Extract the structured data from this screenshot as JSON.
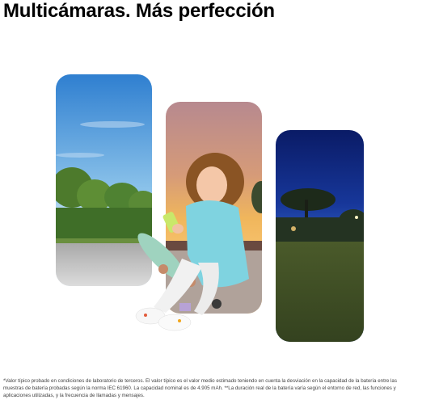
{
  "header": {
    "title": "Multicámaras. Más perfección"
  },
  "photos": [
    {
      "name": "daylight-park-photo"
    },
    {
      "name": "sunset-portrait-photo"
    },
    {
      "name": "night-park-photo"
    }
  ],
  "colors": {
    "sky_day": "#3f8fd8",
    "sky_sunset": "#e0a36c",
    "sky_night": "#0d2370",
    "grass_night": "#3c4e25",
    "hoodie": "#7fd3e0"
  },
  "footnote": {
    "text": "*Valor típico probado en condiciones de laboratorio de terceros. El valor típico es el valor medio estimado teniendo en cuenta la desviación en la capacidad de la batería entre las muestras de batería probadas según la norma IEC 61960. La capacidad nominal es de 4.905 mAh. **La duración real de la batería varía según el entorno de red, las funciones y aplicaciones utilizadas, y la frecuencia de llamadas y mensajes."
  }
}
